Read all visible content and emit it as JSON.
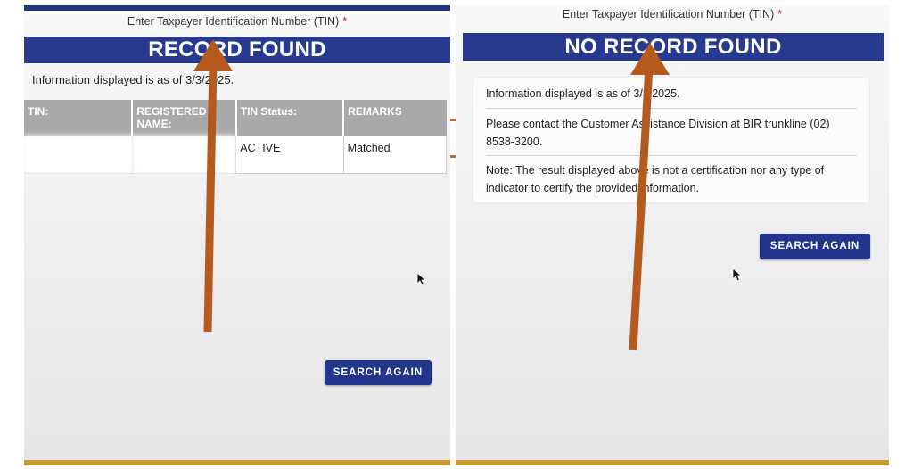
{
  "left": {
    "field_label": "Enter Taxpayer Identification Number (TIN)",
    "required_marker": "*",
    "banner": "RECORD FOUND",
    "info": "Information displayed is as of 3/3/2025.",
    "table": {
      "headers": [
        "TIN:",
        "REGISTERED NAME:",
        "TIN Status:",
        "REMARKS"
      ],
      "rows": [
        [
          "",
          "",
          "ACTIVE",
          "Matched"
        ]
      ]
    },
    "button": "SEARCH AGAIN"
  },
  "right": {
    "field_label": "Enter Taxpayer Identification Number (TIN)",
    "required_marker": "*",
    "banner": "NO RECORD FOUND",
    "messages": [
      "Information displayed is as of 3/3/2025.",
      "Please contact the Customer Assistance Division at BIR trunkline (02) 8538-3200.",
      "Note: The result displayed above is not a certification nor any type of indicator to certify the provided information."
    ],
    "button": "SEARCH AGAIN"
  },
  "colors": {
    "banner": "#273a8f",
    "button": "#23358a",
    "annotation_arrow": "#b55a1e",
    "table_header": "#a9a9ab",
    "required": "#c0202a",
    "gold_accent": "#c99a2e"
  },
  "icons": {
    "cursor": "mouse-pointer-icon",
    "annotation": "up-arrow-annotation"
  }
}
